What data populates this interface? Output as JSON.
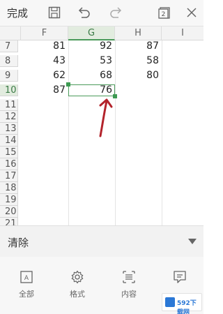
{
  "toolbar": {
    "done_label": "完成",
    "icons": [
      "save-icon",
      "undo-icon",
      "redo-icon",
      "switch-sheet-icon",
      "close-icon"
    ],
    "sheet_badge": "2"
  },
  "columns": [
    "F",
    "G",
    "H",
    "I"
  ],
  "selected_column": "G",
  "rows": [
    {
      "n": "7",
      "F": "81",
      "G": "92",
      "H": "87"
    },
    {
      "n": "8",
      "F": "43",
      "G": "53",
      "H": "58"
    },
    {
      "n": "9",
      "F": "62",
      "G": "68",
      "H": "80"
    },
    {
      "n": "10",
      "F": "87",
      "G": "76",
      "H": ""
    },
    {
      "n": "11"
    },
    {
      "n": "12"
    },
    {
      "n": "13"
    },
    {
      "n": "14"
    },
    {
      "n": "15"
    },
    {
      "n": "16"
    },
    {
      "n": "17"
    },
    {
      "n": "18"
    },
    {
      "n": "19"
    },
    {
      "n": "20"
    },
    {
      "n": "21"
    }
  ],
  "selected_cell": "G10",
  "panel": {
    "title": "清除",
    "options": [
      {
        "label": "全部",
        "icon": "all-icon"
      },
      {
        "label": "格式",
        "icon": "format-gear-icon"
      },
      {
        "label": "内容",
        "icon": "content-icon"
      },
      {
        "label": "批注",
        "icon": "comment-icon"
      }
    ]
  },
  "watermark": "592下载网"
}
